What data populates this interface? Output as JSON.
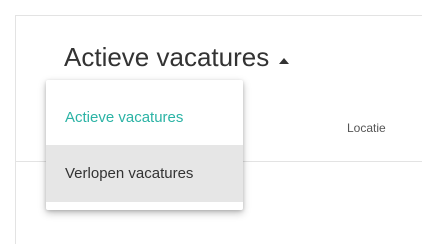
{
  "header": {
    "title": "Actieve vacatures",
    "caret_icon": "caret-up-icon"
  },
  "table": {
    "columns": [
      "Locatie"
    ]
  },
  "dropdown": {
    "items": [
      {
        "label": "Actieve vacatures",
        "state": "selected"
      },
      {
        "label": "Verlopen vacatures",
        "state": "hover"
      }
    ]
  },
  "colors": {
    "accent": "#2bb3a5",
    "text": "#333333",
    "hover_bg": "#e6e6e6",
    "border": "#e3e3e3"
  }
}
